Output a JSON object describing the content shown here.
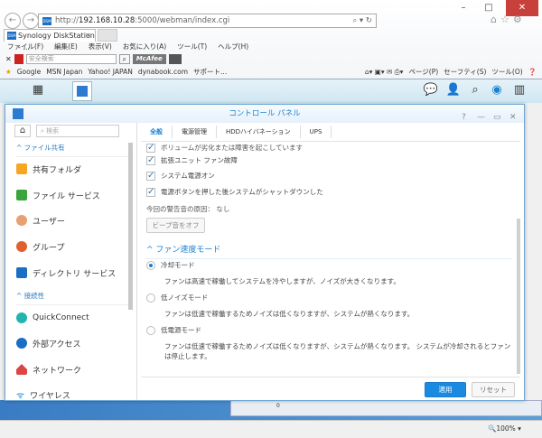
{
  "browser": {
    "url_prefix": "http://",
    "url_host": "192.168.10.28",
    "url_rest": ":5000/webman/index.cgi",
    "tab_title": "Synology DiskStation - ...",
    "menu": [
      "ファイル(F)",
      "編集(E)",
      "表示(V)",
      "お気に入り(A)",
      "ツール(T)",
      "ヘルプ(H)"
    ],
    "search_placeholder": "安全検索",
    "mcafee": "McAfee",
    "favorites": [
      "Google",
      "MSN Japan",
      "Yahoo! JAPAN",
      "dynabook.com",
      "サポート..."
    ],
    "commands": [
      "ページ(P)",
      "セーフティ(S)",
      "ツール(O)"
    ],
    "zoom": "100%",
    "desktop_value": "0"
  },
  "window": {
    "title": "コントロール パネル"
  },
  "sidebar": {
    "search_placeholder": "検索",
    "section1": "ファイル共有",
    "items1": [
      "共有フォルダ",
      "ファイル サービス",
      "ユーザー",
      "グループ",
      "ディレクトリ サービス"
    ],
    "section2": "接続性",
    "items2": [
      "QuickConnect",
      "外部アクセス",
      "ネットワーク",
      "ワイヤレス"
    ]
  },
  "tabs": [
    "全般",
    "電源管理",
    "HDDハイバネーション",
    "UPS"
  ],
  "content": {
    "checks": [
      "ボリュームが劣化または障害を起こしています",
      "拡張ユニット ファン故障",
      "システム電源オン",
      "電源ボタンを押した後システムがシャットダウンした"
    ],
    "reason": "今回の警告音の原因： なし",
    "beep_off": "ビープ音をオフ",
    "fan_section": "ファン速度モード",
    "modes": [
      {
        "label": "冷却モード",
        "desc": "ファンは高速で稼働してシステムを冷やしますが、ノイズが大きくなります。",
        "selected": true
      },
      {
        "label": "低ノイズモード",
        "desc": "ファンは低速で稼働するためノイズは低くなりますが、システムが熱くなります。",
        "selected": false
      },
      {
        "label": "低電源モード",
        "desc": "ファンは低速で稼働するためノイズは低くなりますが、システムが熱くなります。 システムが冷却されるとファンは停止します。",
        "selected": false
      }
    ],
    "apply": "適用",
    "reset": "リセット"
  }
}
